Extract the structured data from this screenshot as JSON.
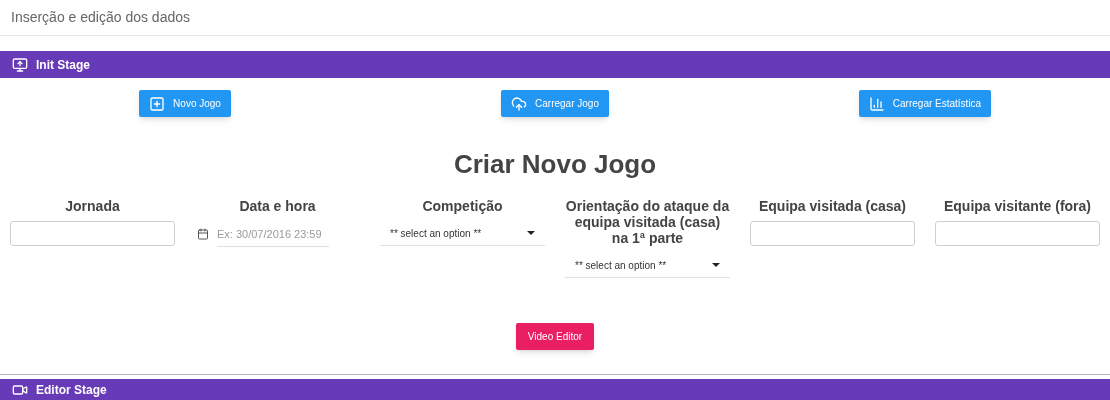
{
  "page_title": "Inserção e edição dos dados",
  "init_stage": {
    "title": "Init Stage"
  },
  "actions": [
    {
      "label": "Novo Jogo",
      "kind": "new"
    },
    {
      "label": "Carregar Jogo",
      "kind": "upload"
    },
    {
      "label": "Carregar Estatística",
      "kind": "stats"
    }
  ],
  "form_title": "Criar Novo Jogo",
  "fields": [
    {
      "label": "Jornada",
      "kind": "text"
    },
    {
      "label": "Data e hora",
      "kind": "date",
      "placeholder": "Ex: 30/07/2016 23:59"
    },
    {
      "label": "Competição",
      "kind": "select",
      "value": "** select an option **"
    },
    {
      "label": "Orientação do ataque da equipa visitada (casa) na 1ª parte",
      "kind": "select",
      "value": "** select an option **"
    },
    {
      "label": "Equipa visitada (casa)",
      "kind": "text"
    },
    {
      "label": "Equipa visitante (fora)",
      "kind": "text"
    }
  ],
  "video_editor_button": "Video Editor",
  "editor_stage": {
    "title": "Editor Stage"
  }
}
